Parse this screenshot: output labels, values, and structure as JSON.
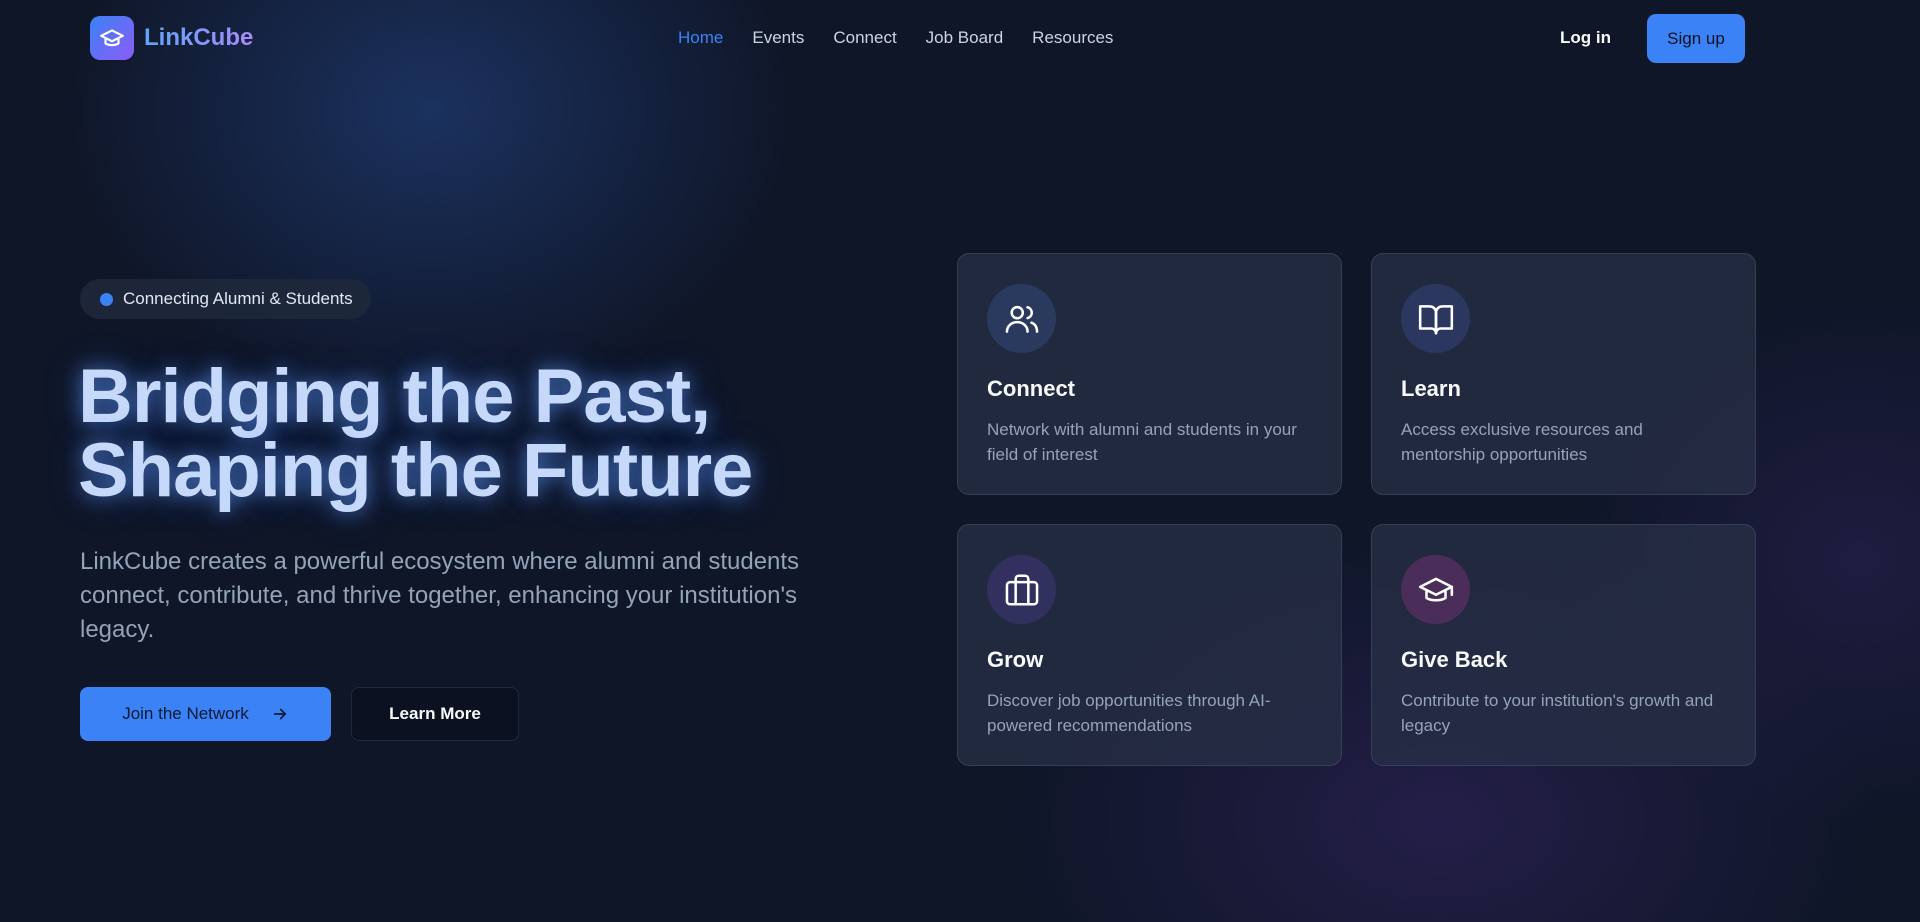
{
  "brand": {
    "name": "LinkCube",
    "logo_icon": "graduation-cap-icon"
  },
  "nav": {
    "links": [
      {
        "label": "Home",
        "active": true
      },
      {
        "label": "Events",
        "active": false
      },
      {
        "label": "Connect",
        "active": false
      },
      {
        "label": "Job Board",
        "active": false
      },
      {
        "label": "Resources",
        "active": false
      }
    ],
    "login_label": "Log in",
    "signup_label": "Sign up"
  },
  "hero": {
    "badge": "Connecting Alumni & Students",
    "headline_line1": "Bridging the Past,",
    "headline_line2": "Shaping the Future",
    "subtext": "LinkCube creates a powerful ecosystem where alumni and students connect, contribute, and thrive together, enhancing your institution's legacy.",
    "primary_button": "Join the Network",
    "secondary_button": "Learn More"
  },
  "features": [
    {
      "icon": "users-icon",
      "title": "Connect",
      "description": "Network with alumni and students in your field of interest"
    },
    {
      "icon": "book-open-icon",
      "title": "Learn",
      "description": "Access exclusive resources and mentorship opportunities"
    },
    {
      "icon": "briefcase-icon",
      "title": "Grow",
      "description": "Discover job opportunities through AI-powered recommendations"
    },
    {
      "icon": "graduation-cap-icon",
      "title": "Give Back",
      "description": "Contribute to your institution's growth and legacy"
    }
  ],
  "colors": {
    "background": "#0f1628",
    "accent": "#3b82f6",
    "logo_gradient_start": "#3b82f6",
    "logo_gradient_end": "#8b5cf6"
  }
}
